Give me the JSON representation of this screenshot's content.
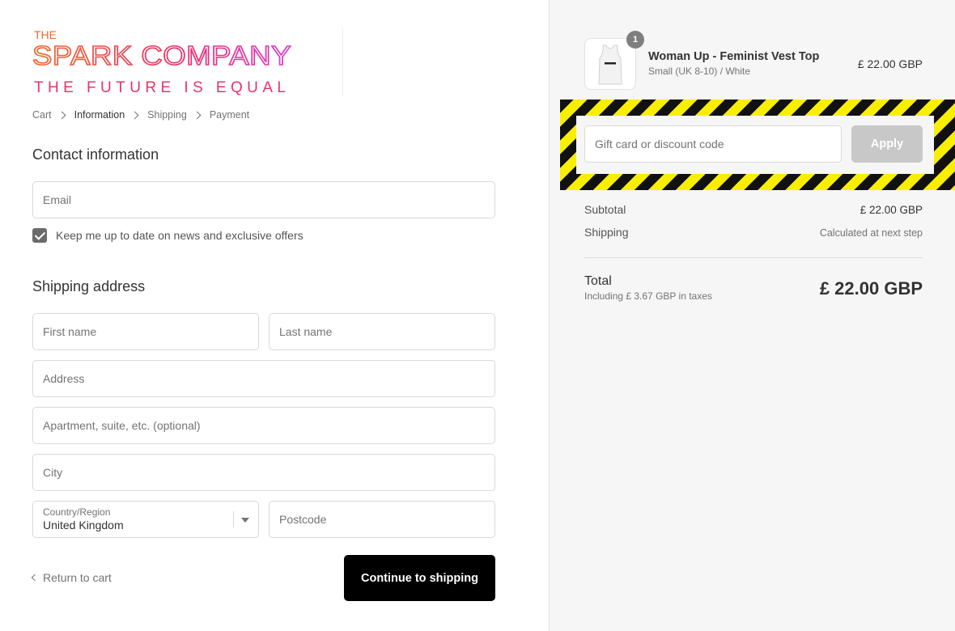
{
  "brand": {
    "line1": "THE",
    "line2": "SPARK COMPANY",
    "tagline": "THE FUTURE IS EQUAL"
  },
  "breadcrumb": [
    "Cart",
    "Information",
    "Shipping",
    "Payment"
  ],
  "contact": {
    "title": "Contact information",
    "email_placeholder": "Email",
    "newsletter_label": "Keep me up to date on news and exclusive offers",
    "newsletter_checked": true
  },
  "shipping": {
    "title": "Shipping address",
    "first_name_placeholder": "First name",
    "last_name_placeholder": "Last name",
    "address_placeholder": "Address",
    "apartment_placeholder": "Apartment, suite, etc. (optional)",
    "city_placeholder": "City",
    "country_label": "Country/Region",
    "country_value": "United Kingdom",
    "postcode_placeholder": "Postcode"
  },
  "actions": {
    "return_label": "Return to cart",
    "continue_label": "Continue to shipping"
  },
  "order": {
    "product_name": "Woman Up - Feminist Vest Top",
    "product_variant": "Small (UK 8-10) / White",
    "product_price": "£ 22.00 GBP",
    "quantity": "1",
    "discount_placeholder": "Gift card or discount code",
    "apply_label": "Apply",
    "subtotal_label": "Subtotal",
    "subtotal_value": "£ 22.00 GBP",
    "shipping_label": "Shipping",
    "shipping_value": "Calculated at next step",
    "total_label": "Total",
    "tax_note": "Including £ 3.67 GBP in taxes",
    "total_value": "£ 22.00 GBP"
  },
  "colors": {
    "primary_button": "#000000",
    "apply_disabled": "#c8c8c8",
    "hazard_yellow": "#f8ee00",
    "hazard_black": "#111111",
    "logo_orange": "#e8622a",
    "logo_pink": "#e0359b"
  }
}
